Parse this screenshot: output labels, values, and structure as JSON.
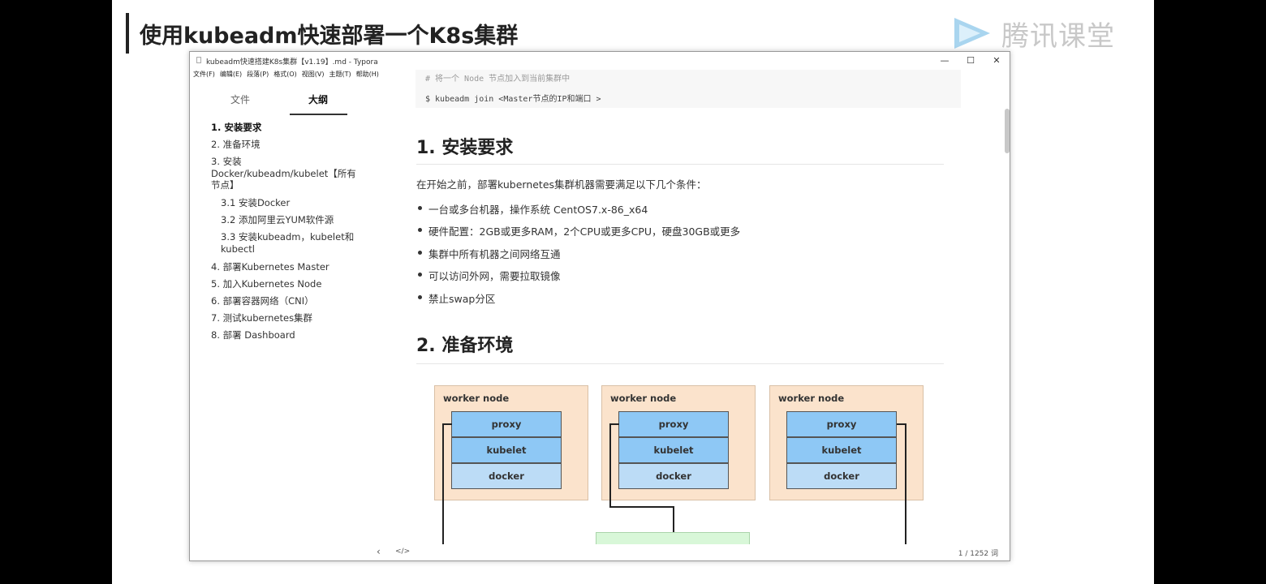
{
  "slide": {
    "title": "使用kubeadm快速部署一个K8s集群",
    "brand": "腾讯课堂"
  },
  "window": {
    "title": "kubeadm快速搭建K8s集群【v1.19】.md - Typora",
    "controls": {
      "minimize": "—",
      "maximize": "☐",
      "close": "✕"
    },
    "menu": [
      "文件(F)",
      "编辑(E)",
      "段落(P)",
      "格式(O)",
      "视图(V)",
      "主题(T)",
      "帮助(H)"
    ]
  },
  "sidebar": {
    "tabs": [
      "文件",
      "大纲"
    ],
    "active_tab": "大纲",
    "outline": [
      "1. 安装要求",
      "2. 准备环境",
      "3. 安装 Docker/kubeadm/kubelet【所有节点】",
      "3.1 安装Docker",
      "3.2 添加阿里云YUM软件源",
      "3.3 安装kubeadm，kubelet和kubectl",
      "4. 部署Kubernetes Master",
      "5. 加入Kubernetes Node",
      "6. 部署容器网络（CNI）",
      "7. 测试kubernetes集群",
      "8. 部署 Dashboard"
    ]
  },
  "content": {
    "code_line1": "# 将一个 Node 节点加入到当前集群中",
    "code_line2": "$ kubeadm join <Master节点的IP和端口 >",
    "h1": "1. 安装要求",
    "intro": "在开始之前，部署kubernetes集群机器需要满足以下几个条件：",
    "bullets": [
      "一台或多台机器，操作系统 CentOS7.x-86_x64",
      "硬件配置：2GB或更多RAM，2个CPU或更多CPU，硬盘30GB或更多",
      "集群中所有机器之间网络互通",
      "可以访问外网，需要拉取镜像",
      "禁止swap分区"
    ],
    "h2": "2. 准备环境",
    "diagram": {
      "nodes": [
        {
          "label": "worker node",
          "layers": [
            "proxy",
            "kubelet",
            "docker"
          ]
        },
        {
          "label": "worker node",
          "layers": [
            "proxy",
            "kubelet",
            "docker"
          ]
        },
        {
          "label": "worker node",
          "layers": [
            "proxy",
            "kubelet",
            "docker"
          ]
        }
      ]
    }
  },
  "status": {
    "nav": "‹",
    "source": "</>",
    "words": "1 / 1252 词"
  }
}
